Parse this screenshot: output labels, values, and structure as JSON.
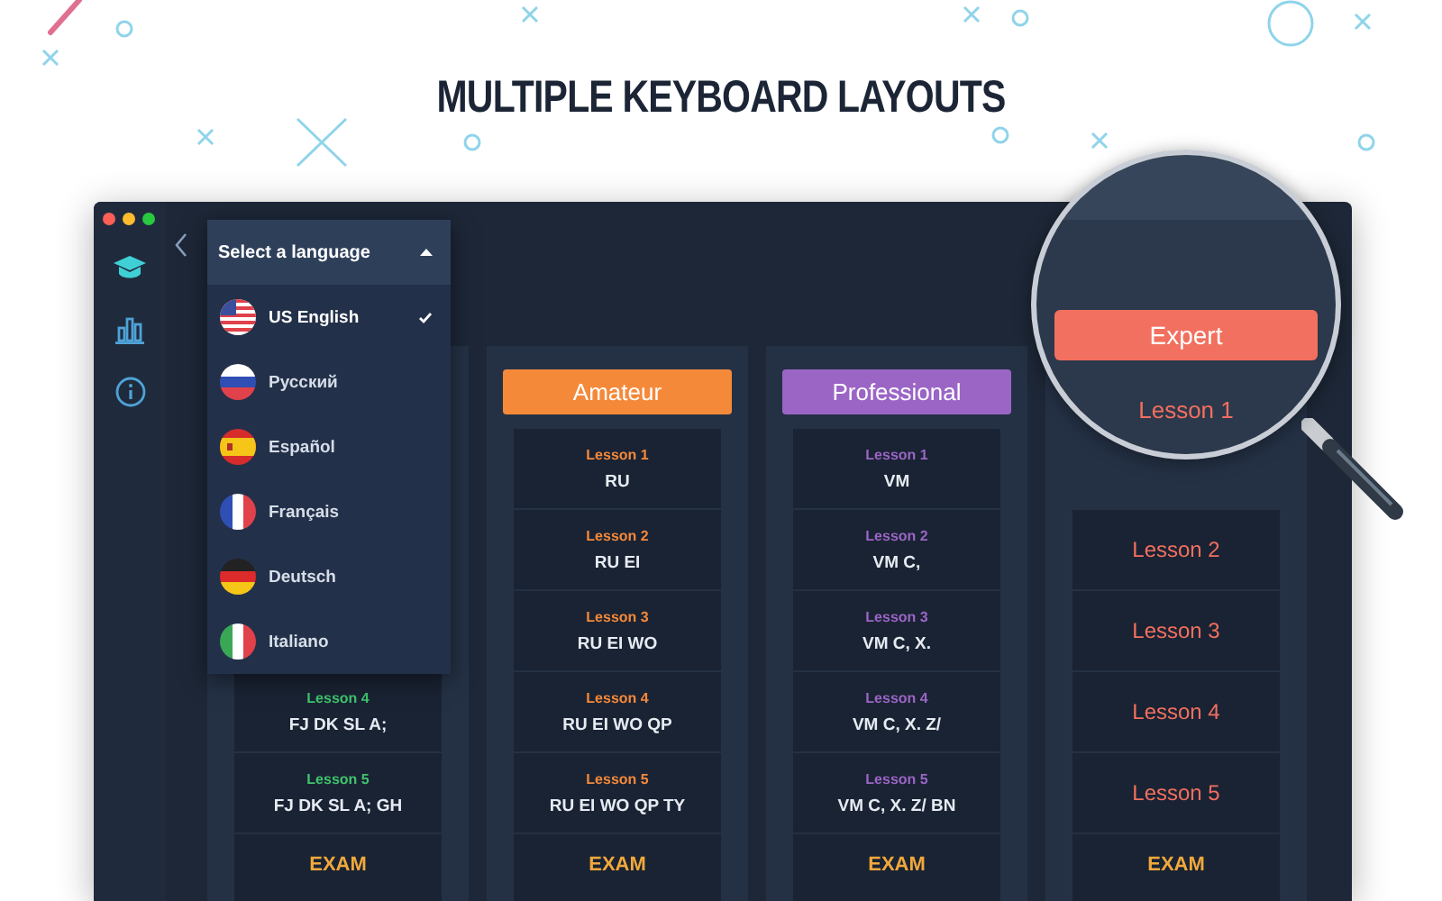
{
  "headline": "MULTIPLE KEYBOARD LAYOUTS",
  "sidebar": {
    "items": [
      {
        "kind": "graduation",
        "selected": true
      },
      {
        "kind": "chart",
        "selected": false
      },
      {
        "kind": "info",
        "selected": false
      }
    ]
  },
  "language_menu": {
    "title": "Select a language",
    "expanded": true,
    "items": [
      {
        "label": "US English",
        "kind": "us",
        "selected": true
      },
      {
        "label": "Русский",
        "kind": "ru",
        "selected": false
      },
      {
        "label": "Español",
        "kind": "es",
        "selected": false
      },
      {
        "label": "Français",
        "kind": "fr",
        "selected": false
      },
      {
        "label": "Deutsch",
        "kind": "de",
        "selected": false
      },
      {
        "label": "Italiano",
        "kind": "it",
        "selected": false
      }
    ]
  },
  "columns": [
    {
      "color": "#3ec46d",
      "lessons": [
        {
          "kind": "keys",
          "title": "Lesson 4",
          "keys": "FJ DK SL A;"
        },
        {
          "kind": "keys",
          "title": "Lesson 5",
          "keys": "FJ DK SL A; GH"
        }
      ],
      "exam": "EXAM"
    },
    {
      "color": "#f5893a",
      "header": "Amateur",
      "lessons": [
        {
          "kind": "keys",
          "title": "Lesson 1",
          "keys": "RU"
        },
        {
          "kind": "keys",
          "title": "Lesson 2",
          "keys": "RU EI"
        },
        {
          "kind": "keys",
          "title": "Lesson 3",
          "keys": "RU EI WO"
        },
        {
          "kind": "keys",
          "title": "Lesson 4",
          "keys": "RU EI WO QP"
        },
        {
          "kind": "keys",
          "title": "Lesson 5",
          "keys": "RU EI WO QP TY"
        }
      ],
      "exam": "EXAM"
    },
    {
      "color": "#9b65c6",
      "header": "Professional",
      "lessons": [
        {
          "kind": "keys",
          "title": "Lesson 1",
          "keys": "VM"
        },
        {
          "kind": "keys",
          "title": "Lesson 2",
          "keys": "VM C,"
        },
        {
          "kind": "keys",
          "title": "Lesson 3",
          "keys": "VM C, X."
        },
        {
          "kind": "keys",
          "title": "Lesson 4",
          "keys": "VM C, X. Z/"
        },
        {
          "kind": "keys",
          "title": "Lesson 5",
          "keys": "VM C, X. Z/ BN"
        }
      ],
      "exam": "EXAM"
    },
    {
      "color": "#f2705f",
      "lessons": [
        {
          "kind": "title",
          "title": "Lesson 2"
        },
        {
          "kind": "title",
          "title": "Lesson 3"
        },
        {
          "kind": "title",
          "title": "Lesson 4"
        },
        {
          "kind": "title",
          "title": "Lesson 5"
        }
      ],
      "exam": "EXAM"
    }
  ],
  "magnifier": {
    "color": "#f2705f",
    "header": "Expert",
    "lesson": "Lesson 1"
  }
}
